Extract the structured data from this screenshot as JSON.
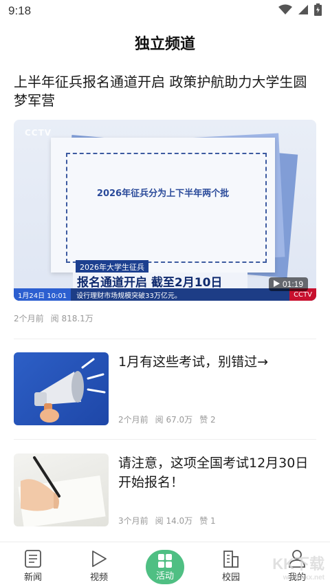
{
  "status_bar": {
    "time": "9:18"
  },
  "header": {
    "title": "独立频道"
  },
  "featured": {
    "title": "上半年征兵报名通道开启 政策护航助力大学生圆梦军营",
    "video": {
      "logo": "CCTV",
      "paper_text": "2026年征兵分为上下半年两个批",
      "tag": "2026年大学生征兵",
      "headline": "报名通道开启 截至2月10日",
      "ticker_date": "1月24日 10:01",
      "ticker_text": "设行理财市场规模突破33万亿元。",
      "ticker_brand": "CCTV",
      "duration": "01:19"
    },
    "time_ago": "2个月前",
    "views": "阅 818.1万"
  },
  "articles": [
    {
      "title": "1月有这些考试，别错过→",
      "time_ago": "2个月前",
      "views": "阅 67.0万",
      "likes": "赞 2"
    },
    {
      "title": "请注意，这项全国考试12月30日开始报名！",
      "time_ago": "3个月前",
      "views": "阅 14.0万",
      "likes": "赞 1"
    }
  ],
  "tabbar": {
    "tabs": [
      {
        "label": "新闻",
        "icon": "news-icon"
      },
      {
        "label": "视频",
        "icon": "play-icon"
      },
      {
        "label": "活动",
        "icon": "grid-icon",
        "active": true
      },
      {
        "label": "校园",
        "icon": "building-icon"
      },
      {
        "label": "我的",
        "icon": "person-icon"
      }
    ]
  },
  "watermark": {
    "main": "KK下载",
    "sub": "www.kkx.net"
  },
  "colors": {
    "accent": "#4fbf83",
    "text": "#1a1a1a",
    "meta": "#999999"
  }
}
